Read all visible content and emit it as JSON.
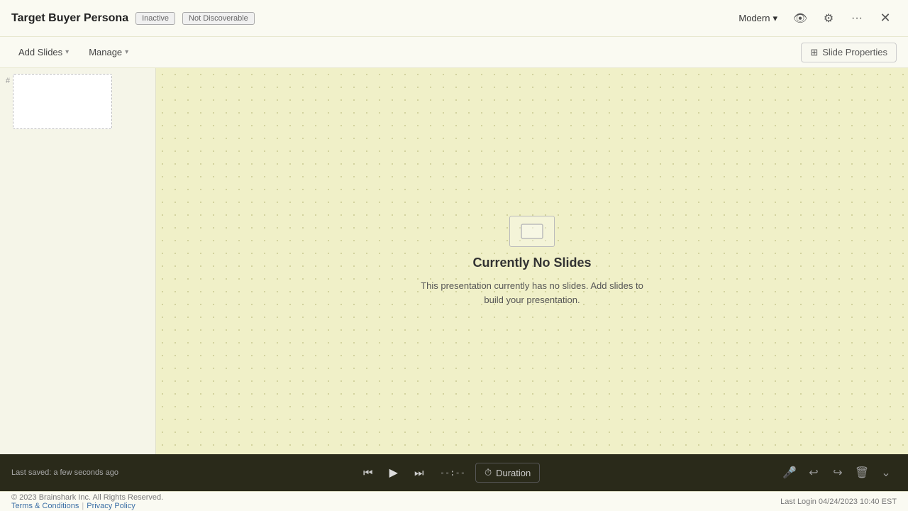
{
  "header": {
    "title": "Target Buyer Persona",
    "badge_inactive": "Inactive",
    "badge_not_discoverable": "Not Discoverable",
    "theme_label": "Modern",
    "icons": {
      "preview": "👁",
      "settings": "⚙",
      "more": "···",
      "close": "✕"
    }
  },
  "toolbar": {
    "add_slides_label": "Add Slides",
    "manage_label": "Manage",
    "slide_properties_label": "Slide Properties"
  },
  "canvas": {
    "empty_title": "Currently No Slides",
    "empty_subtitle": "This presentation currently has no slides. Add slides to build your presentation."
  },
  "playback": {
    "last_saved": "Last saved: a few seconds ago",
    "time_display": "--:--",
    "duration_label": "Duration"
  },
  "footer": {
    "copyright": "© 2023 Brainshark Inc.  All Rights Reserved.",
    "terms_label": "Terms & Conditions",
    "privacy_label": "Privacy Policy",
    "last_login": "Last Login   04/24/2023 10:40 EST"
  }
}
